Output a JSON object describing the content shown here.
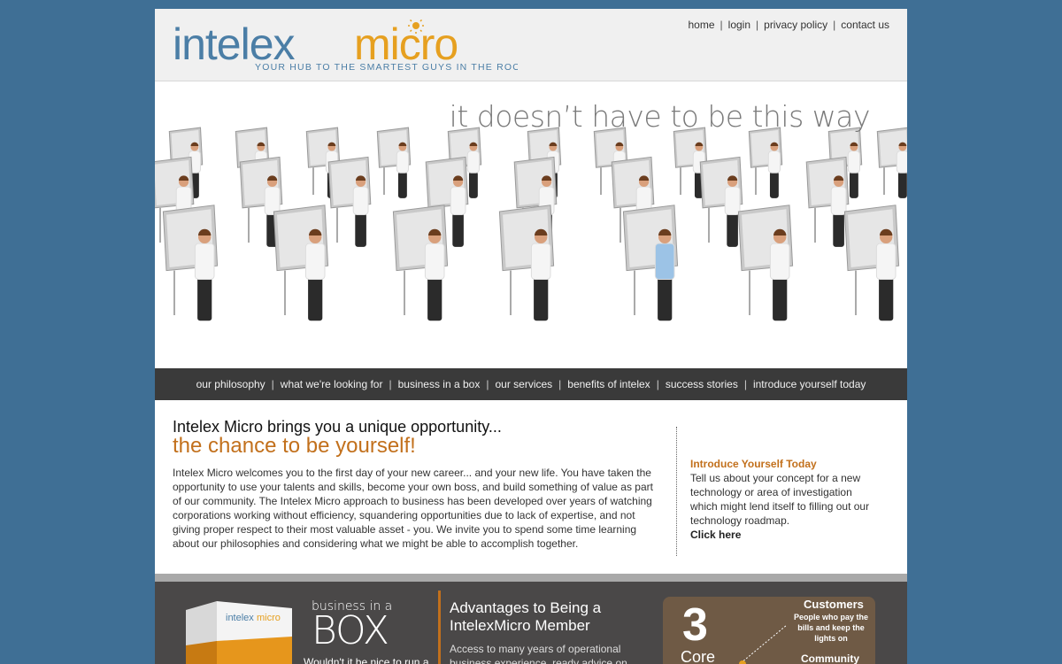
{
  "brand": {
    "logo_part1": "intelex",
    "logo_part2": "micro",
    "tagline": "YOUR HUB TO THE SMARTEST GUYS IN THE ROOM",
    "colors": {
      "blue": "#4b7ea6",
      "orange": "#e6a020",
      "accent": "#c2701c"
    }
  },
  "top_nav": [
    "home",
    "login",
    "privacy policy",
    "contact us"
  ],
  "hero": {
    "tagline": "it doesn’t have to be this way"
  },
  "main_nav": [
    "our philosophy",
    "what we're looking for",
    "business in a box",
    "our services",
    "benefits of intelex",
    "success stories",
    "introduce yourself today"
  ],
  "content": {
    "headline": "Intelex Micro brings you a unique opportunity...",
    "subheadline": "the chance to be yourself!",
    "body": "Intelex Micro welcomes you to the first day of your new career... and your new life. You have taken the opportunity to use your talents and skills, become your own boss, and build something of value as part of our community. The Intelex Micro approach to business has been developed over years of watching corporations working without efficiency, squandering opportunities due to lack of expertise, and not giving proper respect to their most valuable asset - you. We invite you to spend some time learning about our philosophies and considering what we might be able to accomplish together."
  },
  "sidebar": {
    "title": "Introduce Yourself Today",
    "text": "Tell us about your concept for a new technology or area of investigation which might lend itself to filling out our technology roadmap.",
    "link": "Click here"
  },
  "bottom": {
    "box_small": "business in a",
    "box_big": "BOX",
    "box_text": "Wouldn't it be nice to run a",
    "adv_title": "Advantages to Being a IntelexMicro Member",
    "adv_text": "Access to many years of operational business experience, ready advice on",
    "core_number": "3",
    "core_label": "Core",
    "customers_title": "Customers",
    "customers_text": "People who pay the bills and keep the lights on",
    "community_title": "Community"
  }
}
